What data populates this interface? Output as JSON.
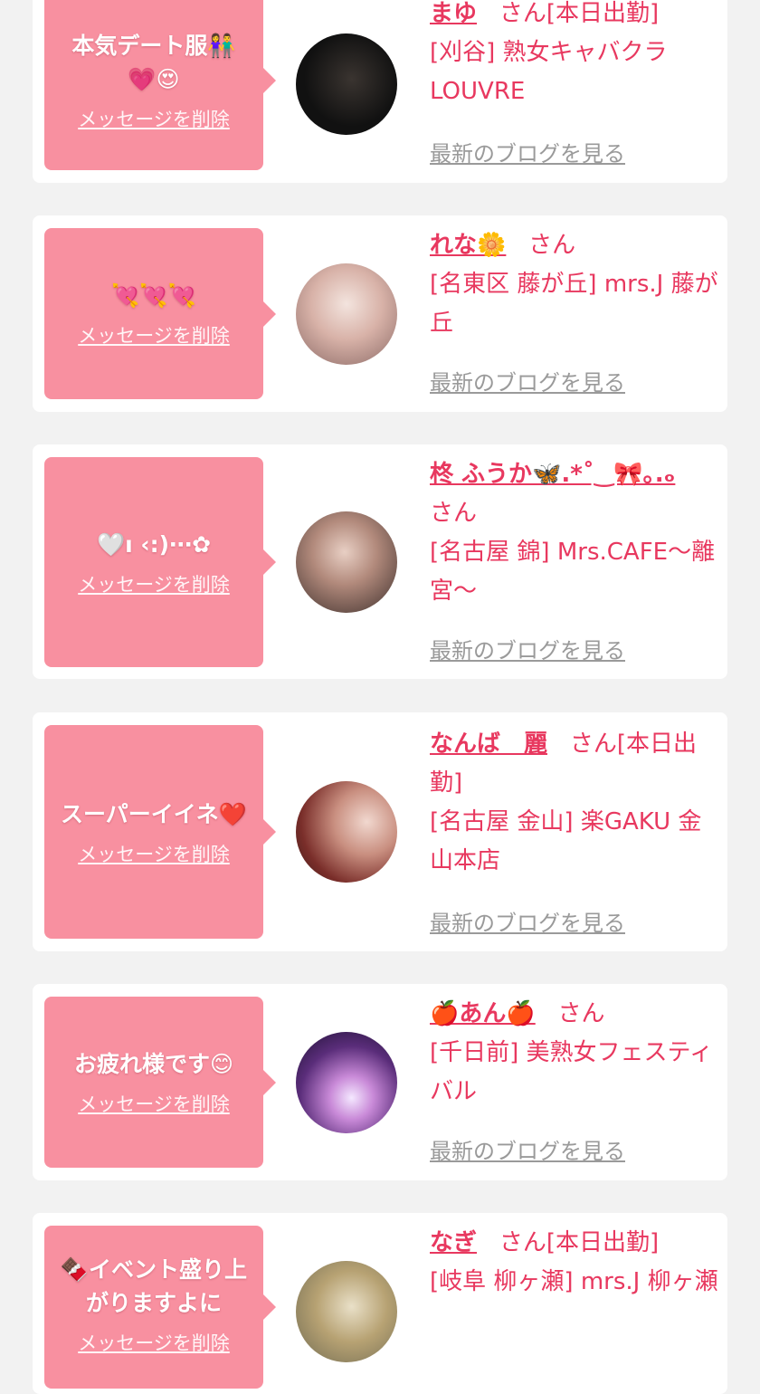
{
  "delete_label": "メッセージを削除",
  "blog_label": "最新のブログを見る",
  "cards": [
    {
      "message": "本気デート服👫\n💗😍",
      "name": "まゆ",
      "san": "さん",
      "status": "[本日出勤]",
      "shop": "[刈谷] 熟女キャバクラ LOUVRE"
    },
    {
      "message": "💘💘💘",
      "name": "れな🌼",
      "san": "さん",
      "status": "",
      "shop": "[名東区 藤が丘] mrs.J 藤が丘"
    },
    {
      "message": "🤍ı ‹:)⋯✿",
      "name": "柊 ふうか🦋.*˚‿🎀｡.ₒ",
      "san": "さん",
      "status": "",
      "shop": "[名古屋 錦] Mrs.CAFE〜離宮〜"
    },
    {
      "message": "スーパーイイネ❤️",
      "name": "なんば　麗",
      "san": "さん",
      "status": "[本日出勤]",
      "shop": "[名古屋 金山] 楽GAKU 金山本店"
    },
    {
      "message": "お疲れ様です😊",
      "name": "🍎あん🍎",
      "san": "さん",
      "status": "",
      "shop": "[千日前] 美熟女フェスティバル"
    },
    {
      "message": "🍫イベント盛り上がりますよに",
      "name": "なぎ",
      "san": "さん",
      "status": "[本日出勤]",
      "shop": "[岐阜 柳ヶ瀬] mrs.J 柳ヶ瀬"
    }
  ],
  "colors": {
    "accent": "#e8385f",
    "bubble": "#f890a0",
    "background": "#f2f2f2"
  }
}
